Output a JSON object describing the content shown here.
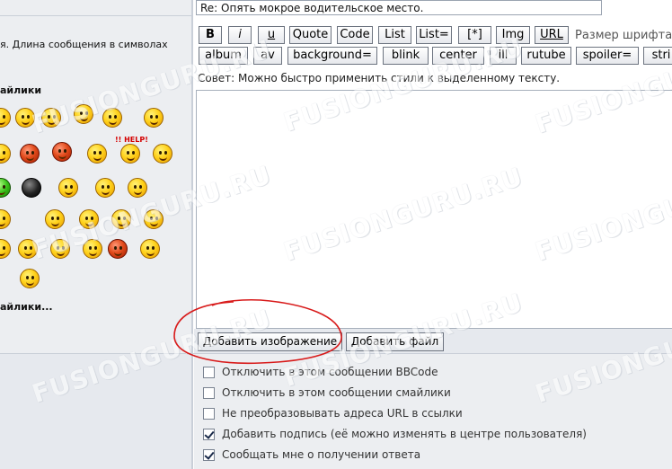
{
  "post": {
    "subject": "Re: Опять мокрое водительское место."
  },
  "left": {
    "description_line1": "я. Длина сообщения в символах",
    "description_line2": "",
    "smilies_heading": "айлики",
    "help_text": "!! HELP!",
    "more_smilies": "айлики..."
  },
  "toolbar": {
    "row1": [
      "B",
      "i",
      "u",
      "Quote",
      "Code",
      "List",
      "List=",
      "[*]",
      "Img",
      "URL"
    ],
    "font_size_label": "Размер шрифта:",
    "row2": [
      "album",
      "av",
      "background=",
      "blink",
      "center",
      "ill",
      "rutube",
      "spoiler=",
      "stri"
    ]
  },
  "tip": "Совет: Можно быстро применить стили к выделенному тексту.",
  "buttons": {
    "add_image": "Добавить изображение",
    "add_file": "Добавить файл"
  },
  "options": [
    {
      "label": "Отключить в этом сообщении BBCode",
      "checked": false
    },
    {
      "label": "Отключить в этом сообщении смайлики",
      "checked": false
    },
    {
      "label": "Не преобразовывать адреса URL в ссылки",
      "checked": false
    },
    {
      "label": "Добавить подпись (её можно изменять в центре пользователя)",
      "checked": true
    },
    {
      "label": "Сообщать мне о получении ответа",
      "checked": true
    }
  ],
  "watermark": "FUSIONGURU.RU",
  "colors": {
    "annotation_circle": "#d81a1a",
    "panel_bg": "#eceef1",
    "border": "#c9cfd8"
  }
}
